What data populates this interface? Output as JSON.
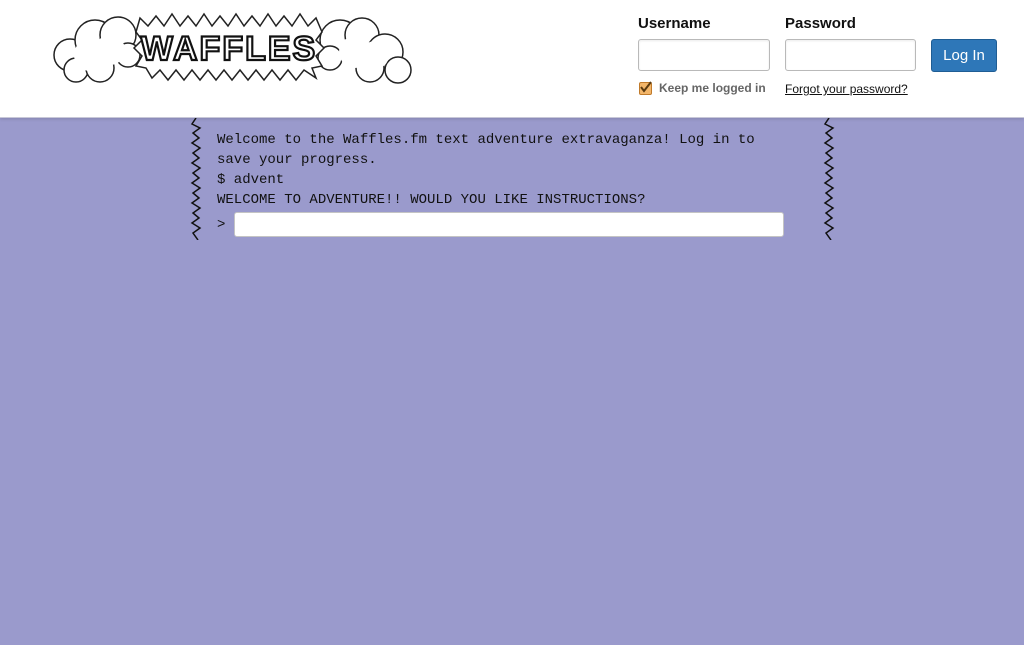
{
  "site": {
    "name": "WAFFLES"
  },
  "login": {
    "username_label": "Username",
    "username_value": "",
    "password_label": "Password",
    "password_value": "",
    "login_button": "Log In",
    "remember_label": "Keep me logged in",
    "remember_checked": true,
    "forgot_link": "Forgot your password?"
  },
  "terminal": {
    "lines": [
      "Welcome to the Waffles.fm text adventure extravaganza! Log in to save your progress.",
      "$ advent",
      "WELCOME TO ADVENTURE!! WOULD YOU LIKE INSTRUCTIONS?"
    ],
    "prompt": ">",
    "input_value": ""
  },
  "colors": {
    "background": "#9a9acc",
    "header": "#ffffff",
    "button": "#2e77b8",
    "checkbox": "#f3b66a"
  }
}
